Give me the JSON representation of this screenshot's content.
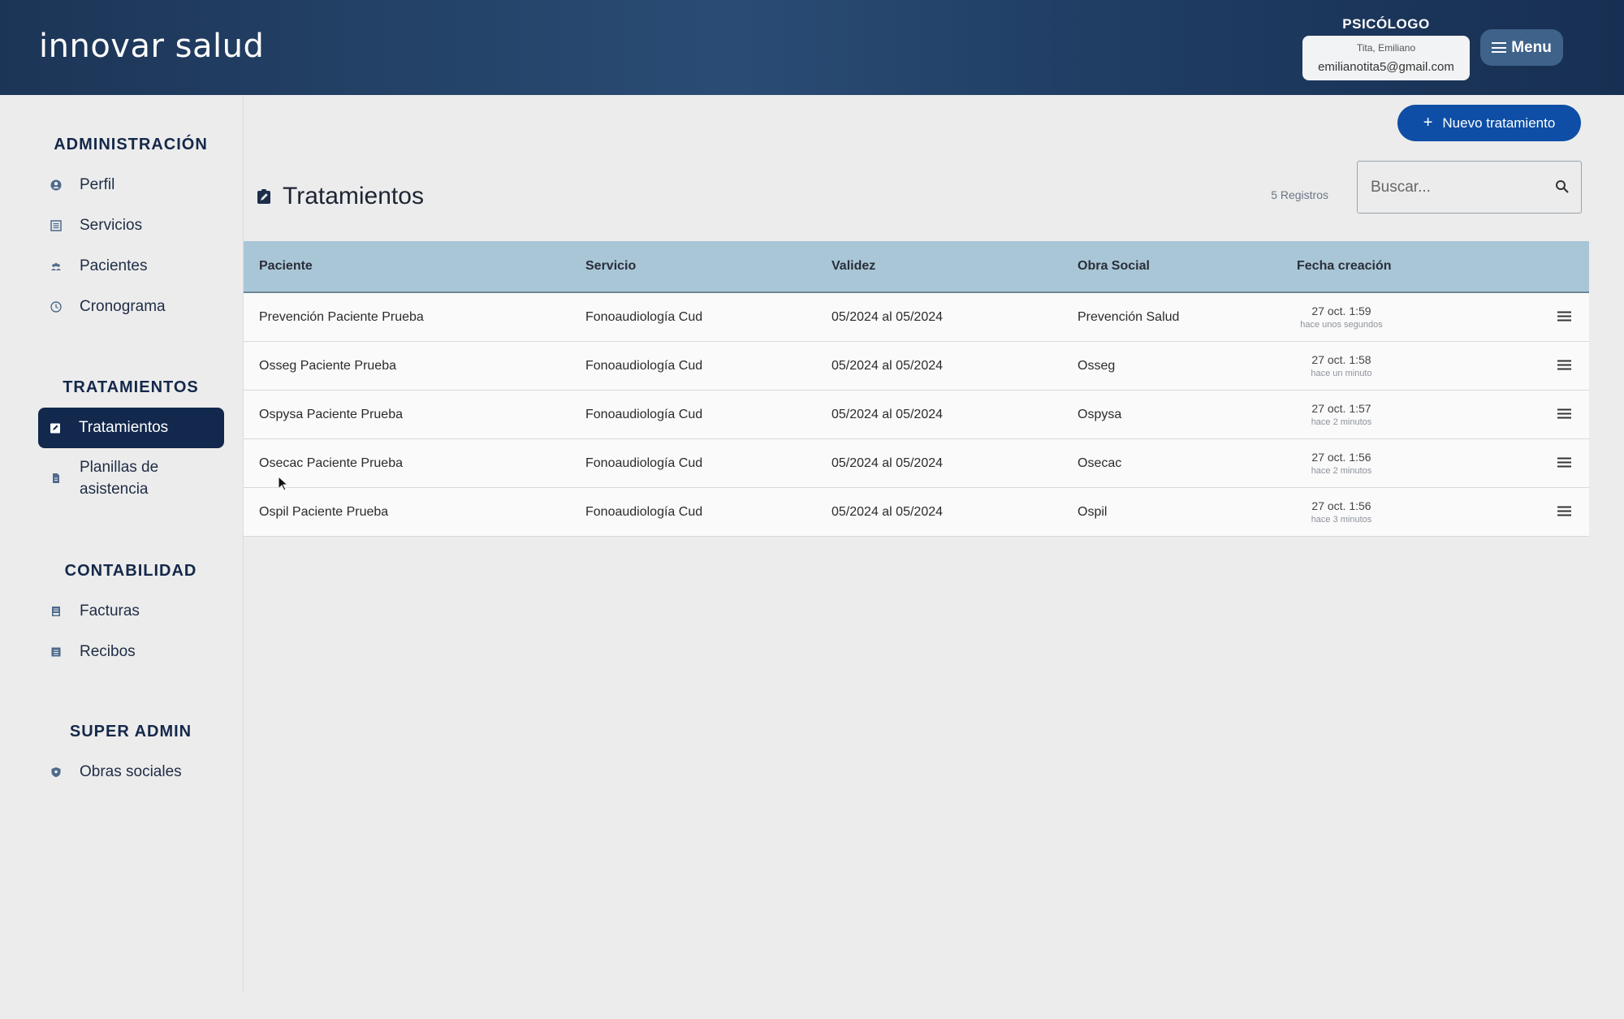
{
  "header": {
    "logo": "innovar salud",
    "role": "PSICÓLOGO",
    "user_name": "Tita, Emiliano",
    "user_email": "emilianotita5@gmail.com",
    "menu_label": "Menu"
  },
  "sidebar": {
    "sections": [
      {
        "title": "ADMINISTRACIÓN",
        "items": [
          {
            "label": "Perfil",
            "icon": "user-circle-icon"
          },
          {
            "label": "Servicios",
            "icon": "list-icon"
          },
          {
            "label": "Pacientes",
            "icon": "people-icon"
          },
          {
            "label": "Cronograma",
            "icon": "clock-icon"
          }
        ]
      },
      {
        "title": "TRATAMIENTOS",
        "items": [
          {
            "label": "Tratamientos",
            "icon": "clipboard-edit-icon",
            "active": true
          },
          {
            "label": "Planillas de asistencia",
            "icon": "document-icon"
          }
        ]
      },
      {
        "title": "CONTABILIDAD",
        "items": [
          {
            "label": "Facturas",
            "icon": "invoice-icon"
          },
          {
            "label": "Recibos",
            "icon": "receipt-icon"
          }
        ]
      },
      {
        "title": "SUPER ADMIN",
        "items": [
          {
            "label": "Obras sociales",
            "icon": "shield-icon"
          }
        ]
      }
    ]
  },
  "main": {
    "new_button": "Nuevo tratamiento",
    "title": "Tratamientos",
    "count": "5 Registros",
    "search_placeholder": "Buscar...",
    "columns": [
      "Paciente",
      "Servicio",
      "Validez",
      "Obra Social",
      "Fecha creación"
    ],
    "rows": [
      {
        "paciente": "Prevención Paciente Prueba",
        "servicio": "Fonoaudiología Cud",
        "validez": "05/2024 al 05/2024",
        "obra": "Prevención Salud",
        "fecha": "27 oct. 1:59",
        "rel": "hace unos segundos"
      },
      {
        "paciente": "Osseg Paciente Prueba",
        "servicio": "Fonoaudiología Cud",
        "validez": "05/2024 al 05/2024",
        "obra": "Osseg",
        "fecha": "27 oct. 1:58",
        "rel": "hace un minuto"
      },
      {
        "paciente": "Ospysa Paciente Prueba",
        "servicio": "Fonoaudiología Cud",
        "validez": "05/2024 al 05/2024",
        "obra": "Ospysa",
        "fecha": "27 oct. 1:57",
        "rel": "hace 2 minutos"
      },
      {
        "paciente": "Osecac Paciente Prueba",
        "servicio": "Fonoaudiología Cud",
        "validez": "05/2024 al 05/2024",
        "obra": "Osecac",
        "fecha": "27 oct. 1:56",
        "rel": "hace 2 minutos"
      },
      {
        "paciente": "Ospil Paciente Prueba",
        "servicio": "Fonoaudiología Cud",
        "validez": "05/2024 al 05/2024",
        "obra": "Ospil",
        "fecha": "27 oct. 1:56",
        "rel": "hace 3 minutos"
      }
    ]
  },
  "colors": {
    "header_dark": "#1c3557",
    "active_nav": "#12284c",
    "primary_button": "#0e4ea6",
    "table_header": "#a9c6d7"
  }
}
